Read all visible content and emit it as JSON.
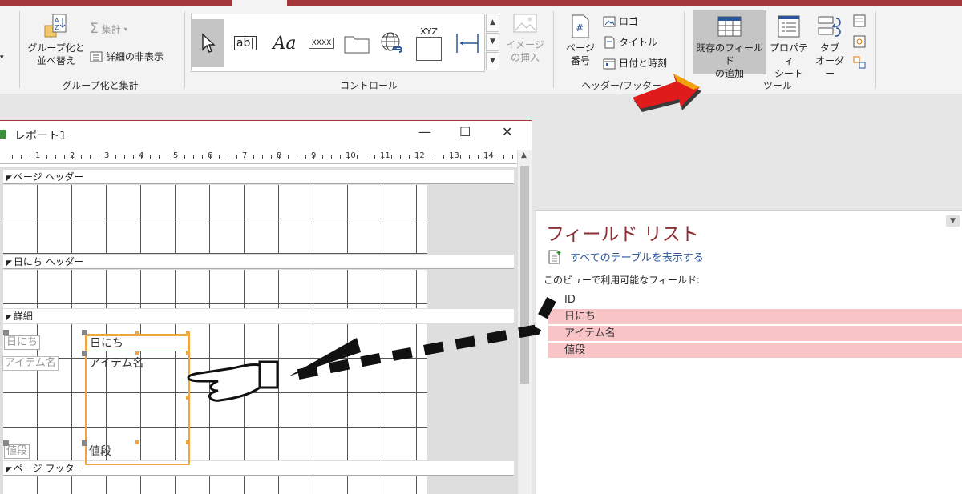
{
  "ribbon": {
    "group_sort": {
      "group_label": "グループ化と集計",
      "group_sort_button": "グループ化と\n並べ替え",
      "totals_label": "集計",
      "hide_details_label": "詳細の非表示"
    },
    "controls": {
      "group_label": "コントロール",
      "textbox_label": "ab|",
      "label_glyph": "Aa",
      "xxxx_label": "XXXX",
      "xyz_label": "XYZ",
      "insert_image_label": "イメージ\nの挿入"
    },
    "header_footer": {
      "group_label": "ヘッダー/フッター",
      "page_number_label": "ページ\n番号",
      "logo_label": "ロゴ",
      "title_label": "タイトル",
      "datetime_label": "日付と時刻"
    },
    "tools": {
      "group_label": "ツール",
      "add_fields_label": "既存のフィールド\nの追加",
      "property_sheet_label": "プロパティ\nシート",
      "tab_order_label": "タブ\nオーダー"
    }
  },
  "report_window": {
    "title": "レポート1",
    "ruler_numbers": [
      "1",
      "2",
      "3",
      "4",
      "5",
      "6",
      "7",
      "8",
      "9",
      "10",
      "11",
      "12",
      "13",
      "14"
    ],
    "sections": {
      "page_header": "ページ ヘッダー",
      "group_header": "日にち ヘッダー",
      "detail": "詳細",
      "page_footer": "ページ フッター"
    },
    "controls": {
      "label_date": "日にち",
      "label_item": "アイテム名",
      "label_price": "値段",
      "box_date": "日にち",
      "box_item": "アイテム名",
      "box_price": "値段"
    }
  },
  "field_list": {
    "title": "フィールド リスト",
    "show_all_link": "すべてのテーブルを表示する",
    "available_label": "このビューで利用可能なフィールド:",
    "fields": [
      {
        "name": "ID",
        "highlighted": false
      },
      {
        "name": "日にち",
        "highlighted": true
      },
      {
        "name": "アイテム名",
        "highlighted": true
      },
      {
        "name": "値段",
        "highlighted": true
      }
    ]
  },
  "colors": {
    "accent": "#a4373a",
    "field_highlight": "#f9c4c6",
    "selection_orange": "#f0a640",
    "arrow_red": "#e01b1b"
  }
}
